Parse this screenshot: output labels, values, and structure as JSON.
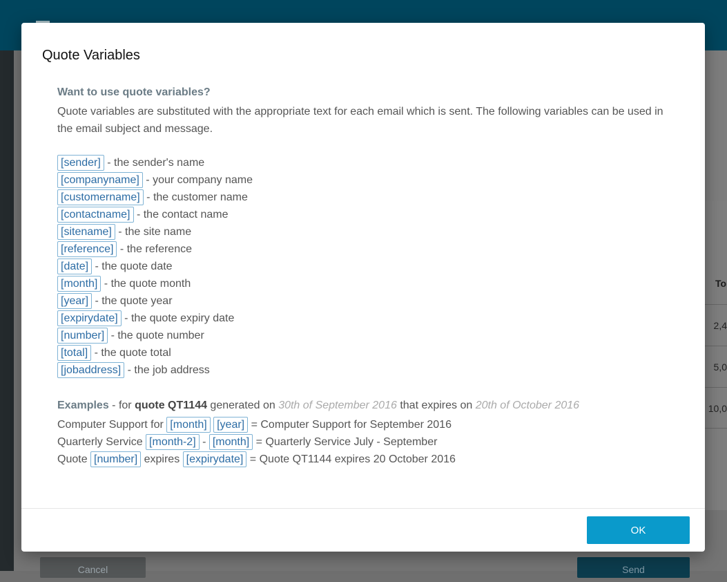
{
  "background": {
    "table_header": "To",
    "table_cells": [
      "2,4",
      "5,0",
      "10,0"
    ],
    "cancel_label": "Cancel",
    "send_label": "Send"
  },
  "dialog": {
    "title": "Quote Variables",
    "heading": "Want to use quote variables?",
    "intro": "Quote variables are substituted with the appropriate text for each email which is sent. The following variables can be used in the email subject and message.",
    "variables": [
      {
        "tag": "[sender]",
        "desc": " - the sender's name"
      },
      {
        "tag": "[companyname]",
        "desc": " - your company name"
      },
      {
        "tag": "[customername]",
        "desc": " - the customer name"
      },
      {
        "tag": "[contactname]",
        "desc": " - the contact name"
      },
      {
        "tag": "[sitename]",
        "desc": " - the site name"
      },
      {
        "tag": "[reference]",
        "desc": " - the reference"
      },
      {
        "tag": "[date]",
        "desc": " - the quote date"
      },
      {
        "tag": "[month]",
        "desc": " - the quote month"
      },
      {
        "tag": "[year]",
        "desc": " - the quote year"
      },
      {
        "tag": "[expirydate]",
        "desc": " - the quote expiry date"
      },
      {
        "tag": "[number]",
        "desc": " - the quote number"
      },
      {
        "tag": "[total]",
        "desc": " - the quote total"
      },
      {
        "tag": "[jobaddress]",
        "desc": " - the job address"
      }
    ],
    "examples": {
      "label": "Examples",
      "for_text": " - for ",
      "quote_id": "quote QT1144",
      "generated_on": " generated on ",
      "generated_date": "30th of September 2016",
      "expires_on": " that expires on ",
      "expiry_date": "20th of October 2016",
      "rows": [
        {
          "prefix": "Computer Support for ",
          "tag1": "[month]",
          "mid": " ",
          "tag2": "[year]",
          "result": " = Computer Support for September 2016"
        },
        {
          "prefix": "Quarterly Service ",
          "tag1": "[month-2]",
          "mid": " - ",
          "tag2": "[month]",
          "result": " = Quarterly Service July - September"
        },
        {
          "prefix": "Quote ",
          "tag1": "[number]",
          "mid": " expires ",
          "tag2": "[expirydate]",
          "result": " = Quote QT1144 expires 20 October 2016"
        }
      ]
    },
    "ok_label": "OK"
  }
}
